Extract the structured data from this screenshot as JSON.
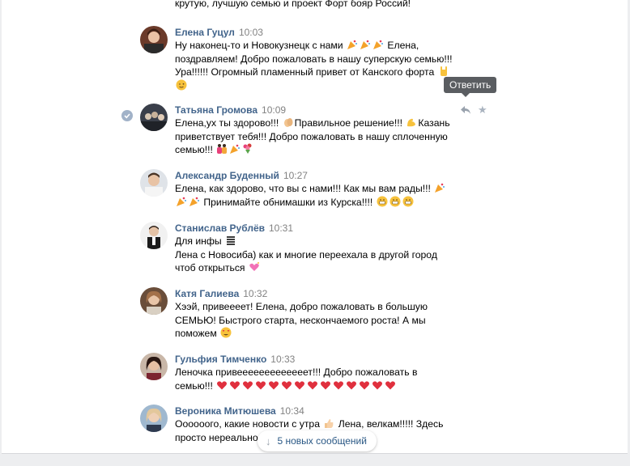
{
  "chat": {
    "top_text": "крутую, лучшую семью и проект Форт бояр Россий!",
    "messages": [
      {
        "author": "Елена Гуцул",
        "time": "10:03",
        "lines": [
          "Ну наконец-то и Новокузнецк с нами",
          "поздравляем! Добро пожаловать в нашу суперскую семью!!!",
          "Ура!!!!!! Огромный пламенный привет от Канского форта",
          ""
        ]
      },
      {
        "author": "Татьяна Громова",
        "time": "10:09",
        "lines": [
          "Елена,ух ты здорово!!!",
          "Правильное решение!!!",
          "Казань",
          "приветствует тебя!!! Добро пожаловать в нашу сплоченную",
          "семью!!!"
        ]
      },
      {
        "author": "Александр Буденный",
        "time": "10:27",
        "lines": [
          "Елена, как здорово, что вы с нами!!! Как мы вам рады!!!",
          "Принимайте обнимашки из Курска!!!!"
        ]
      },
      {
        "author": "Станислав Рублёв",
        "time": "10:31",
        "lines": [
          "Для инфы",
          "Лена с Новосиба) как и многие переехала в другой город",
          "чтоб открыться"
        ]
      },
      {
        "author": "Катя Галиева",
        "time": "10:32",
        "lines": [
          "Хээй, привеееет! Елена, добро пожаловать в большую",
          "СЕМЬЮ! Быстрого старта, нескончаемого роста! А мы",
          "поможем"
        ]
      },
      {
        "author": "Гульфия Тимченко",
        "time": "10:33",
        "lines": [
          "Леночка привееееееееееееет!!! Добро пожаловать в",
          "семью!!!"
        ]
      },
      {
        "author": "Вероника Митюшева",
        "time": "10:34",
        "lines": [
          "Оооооого, какие новости с утра",
          "Лена, велкам!!!!! Здесь",
          "просто нереально"
        ]
      }
    ]
  },
  "tooltip": "Ответить",
  "new_messages_button": "5 новых сообщений",
  "colors": {
    "author": "#42648b",
    "time": "#828282",
    "accent": "#2a5885",
    "tooltip_bg": "#5a5d61"
  },
  "icons": [
    "reply-icon",
    "star-icon",
    "check-icon",
    "arrow-down-icon"
  ]
}
